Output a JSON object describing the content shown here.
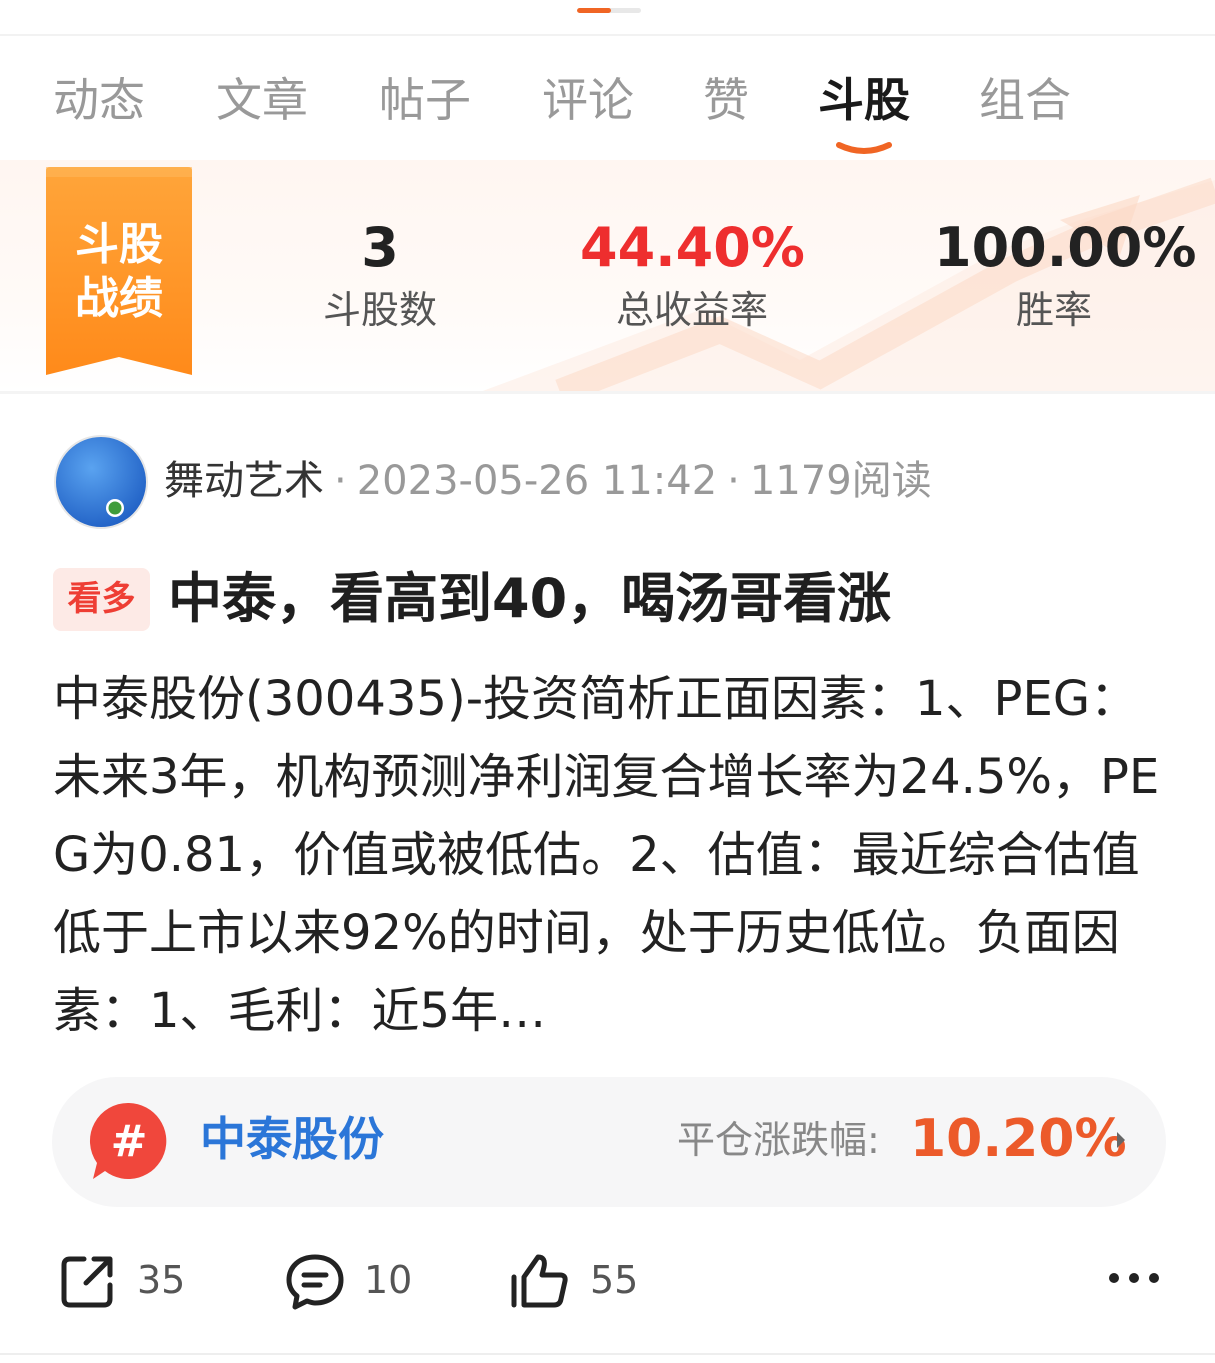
{
  "tabs": [
    {
      "label": "动态",
      "active": false
    },
    {
      "label": "文章",
      "active": false
    },
    {
      "label": "帖子",
      "active": false
    },
    {
      "label": "评论",
      "active": false
    },
    {
      "label": "赞",
      "active": false
    },
    {
      "label": "斗股",
      "active": true
    },
    {
      "label": "组合",
      "active": false
    }
  ],
  "stats": {
    "badge_line1": "斗股",
    "badge_line2": "战绩",
    "count_value": "3",
    "count_label": "斗股数",
    "return_value": "44.40%",
    "return_label": "总收益率",
    "winrate_value": "100.00%",
    "winrate_label": "胜率"
  },
  "post": {
    "author": "舞动艺术",
    "separator": "·",
    "datetime": "2023-05-26 11:42",
    "reads": "1179阅读",
    "tag": "看多",
    "title": "中泰，看高到40，喝汤哥看涨",
    "body": "中泰股份(300435)-投资简析正面因素：1、PEG：未来3年，机构预测净利润复合增长率为24.5%，PEG为0.81，价值或被低估。2、估值：最近综合估值低于上市以来92%的时间，处于历史低位。负面因素：1、毛利：近5年…",
    "stock": {
      "hash_symbol": "#",
      "name": "中泰股份",
      "change_label": "平仓涨跌幅:",
      "change_value": "10.20%"
    },
    "actions": {
      "share_count": "35",
      "comment_count": "10",
      "like_count": "55"
    }
  },
  "colors": {
    "accent_orange": "#f06524",
    "positive_red": "#ee2e2e",
    "stock_blue": "#2b76d8",
    "change_orange": "#ec5a2a"
  },
  "icons": [
    "share-icon",
    "comment-icon",
    "like-icon",
    "more-icon",
    "hash-icon",
    "chevron-right-icon"
  ]
}
